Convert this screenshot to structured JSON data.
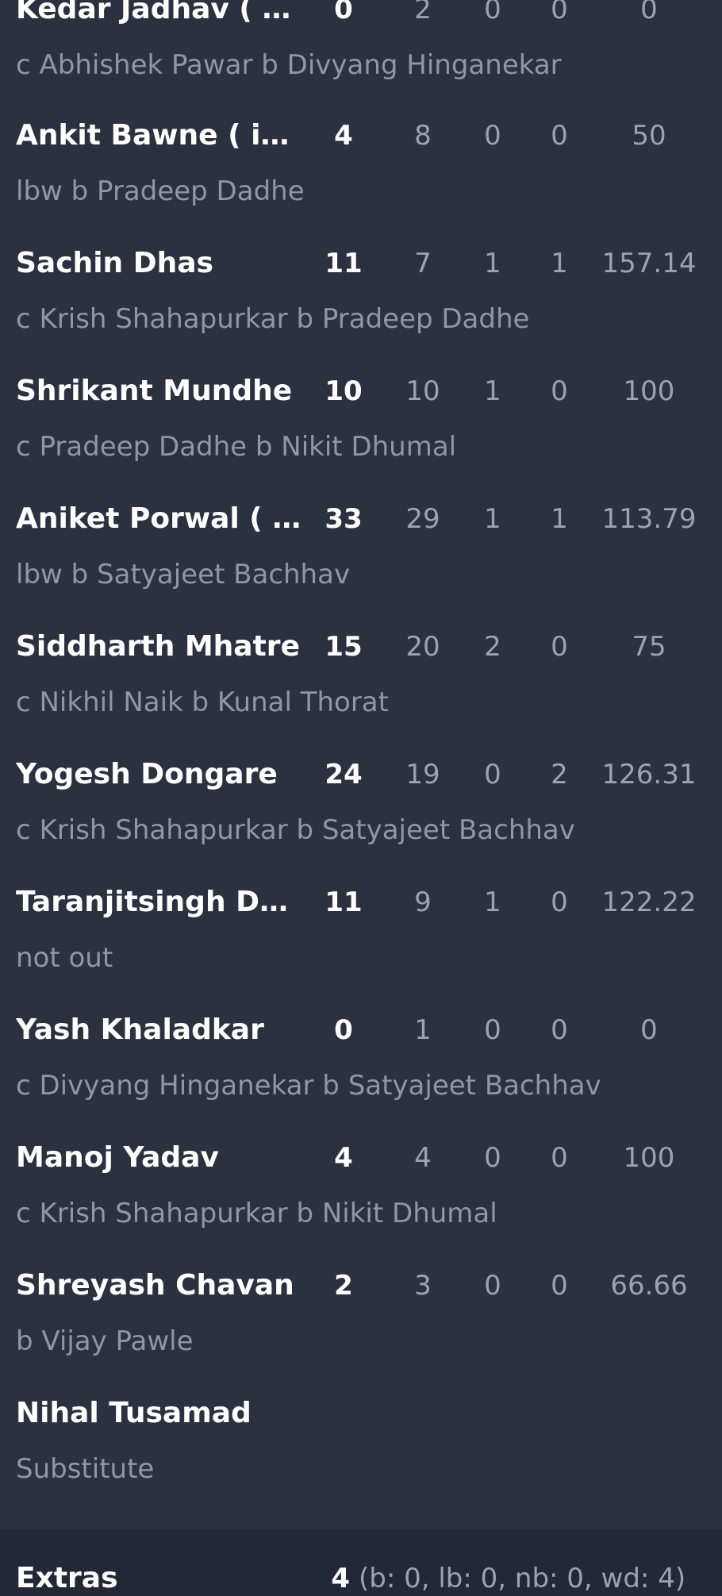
{
  "batters": [
    {
      "name": "Kedar Jadhav ( c )",
      "runs": "0",
      "balls": "2",
      "fours": "0",
      "sixes": "0",
      "sr": "0",
      "dismissal": "c Abhishek Pawar b Divyang Hinganekar"
    },
    {
      "name": "Ankit Bawne ( ip )",
      "runs": "4",
      "balls": "8",
      "fours": "0",
      "sixes": "0",
      "sr": "50",
      "dismissal": "lbw b Pradeep Dadhe"
    },
    {
      "name": "Sachin Dhas",
      "runs": "11",
      "balls": "7",
      "fours": "1",
      "sixes": "1",
      "sr": "157.14",
      "dismissal": "c Krish Shahapurkar b Pradeep Dadhe"
    },
    {
      "name": "Shrikant Mundhe",
      "runs": "10",
      "balls": "10",
      "fours": "1",
      "sixes": "0",
      "sr": "100",
      "dismissal": "c Pradeep Dadhe b Nikit Dhumal"
    },
    {
      "name": "Aniket Porwal ( wk )",
      "runs": "33",
      "balls": "29",
      "fours": "1",
      "sixes": "1",
      "sr": "113.79",
      "dismissal": "lbw b Satyajeet Bachhav"
    },
    {
      "name": "Siddharth Mhatre",
      "runs": "15",
      "balls": "20",
      "fours": "2",
      "sixes": "0",
      "sr": "75",
      "dismissal": "c Nikhil Naik b Kunal Thorat"
    },
    {
      "name": "Yogesh Dongare",
      "runs": "24",
      "balls": "19",
      "fours": "0",
      "sixes": "2",
      "sr": "126.31",
      "dismissal": "c Krish Shahapurkar b Satyajeet Bachhav"
    },
    {
      "name": "Taranjitsingh Dhil…",
      "runs": "11",
      "balls": "9",
      "fours": "1",
      "sixes": "0",
      "sr": "122.22",
      "dismissal": "not out"
    },
    {
      "name": "Yash Khaladkar",
      "runs": "0",
      "balls": "1",
      "fours": "0",
      "sixes": "0",
      "sr": "0",
      "dismissal": "c Divyang Hinganekar b Satyajeet Bachhav"
    },
    {
      "name": "Manoj Yadav",
      "runs": "4",
      "balls": "4",
      "fours": "0",
      "sixes": "0",
      "sr": "100",
      "dismissal": "c Krish Shahapurkar b Nikit Dhumal"
    },
    {
      "name": "Shreyash Chavan",
      "runs": "2",
      "balls": "3",
      "fours": "0",
      "sixes": "0",
      "sr": "66.66",
      "dismissal": "b Vijay Pawle"
    },
    {
      "name": "Nihal Tusamad",
      "runs": "",
      "balls": "",
      "fours": "",
      "sixes": "",
      "sr": "",
      "dismissal": "Substitute"
    }
  ],
  "extras": {
    "label": "Extras",
    "total": "4",
    "breakdown": "(b: 0, lb: 0, nb: 0, wd: 4)"
  },
  "colors": {
    "background": "#2b313e",
    "extras_background": "#232836",
    "primary_text": "#ffffff",
    "secondary_text": "#9aa2b5"
  }
}
